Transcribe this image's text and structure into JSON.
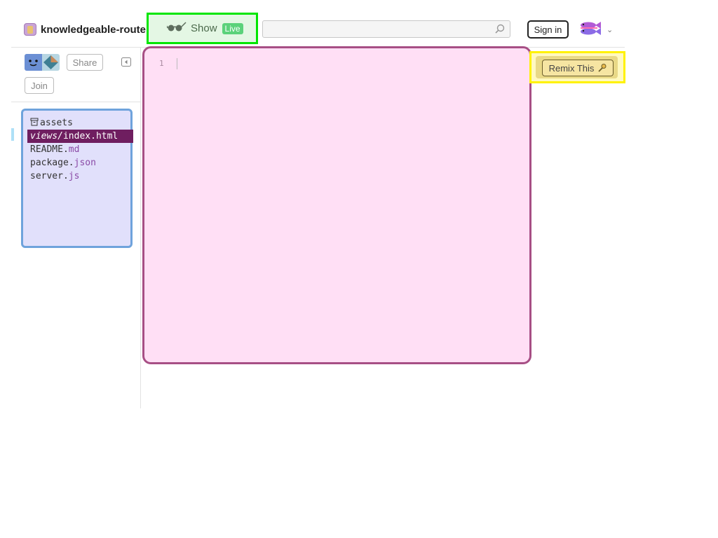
{
  "header": {
    "project_name": "knowledgeable-router",
    "show_label": "Show",
    "live_badge": "Live",
    "search_placeholder": "",
    "sign_in_label": "Sign in"
  },
  "sidebar": {
    "share_label": "Share",
    "join_label": "Join",
    "files": [
      {
        "icon": "folder-icon",
        "dir": "",
        "name": "assets",
        "ext": ""
      },
      {
        "icon": "",
        "dir": "views/",
        "name": "index.",
        "ext": "html"
      },
      {
        "icon": "",
        "dir": "",
        "name": "README.",
        "ext": "md"
      },
      {
        "icon": "",
        "dir": "",
        "name": "package.",
        "ext": "json"
      },
      {
        "icon": "",
        "dir": "",
        "name": "server.",
        "ext": "js"
      }
    ],
    "selected_index": 1
  },
  "editor": {
    "line_numbers": [
      "1"
    ]
  },
  "remix": {
    "label": "Remix This"
  },
  "colors": {
    "show_highlight": "#00e600",
    "live_badge": "#5bd27a",
    "file_panel_bg": "#e1e0fb",
    "selected_file_bg": "#6f1e60",
    "editor_bg": "#ffdff5",
    "remix_highlight": "#fff200"
  }
}
